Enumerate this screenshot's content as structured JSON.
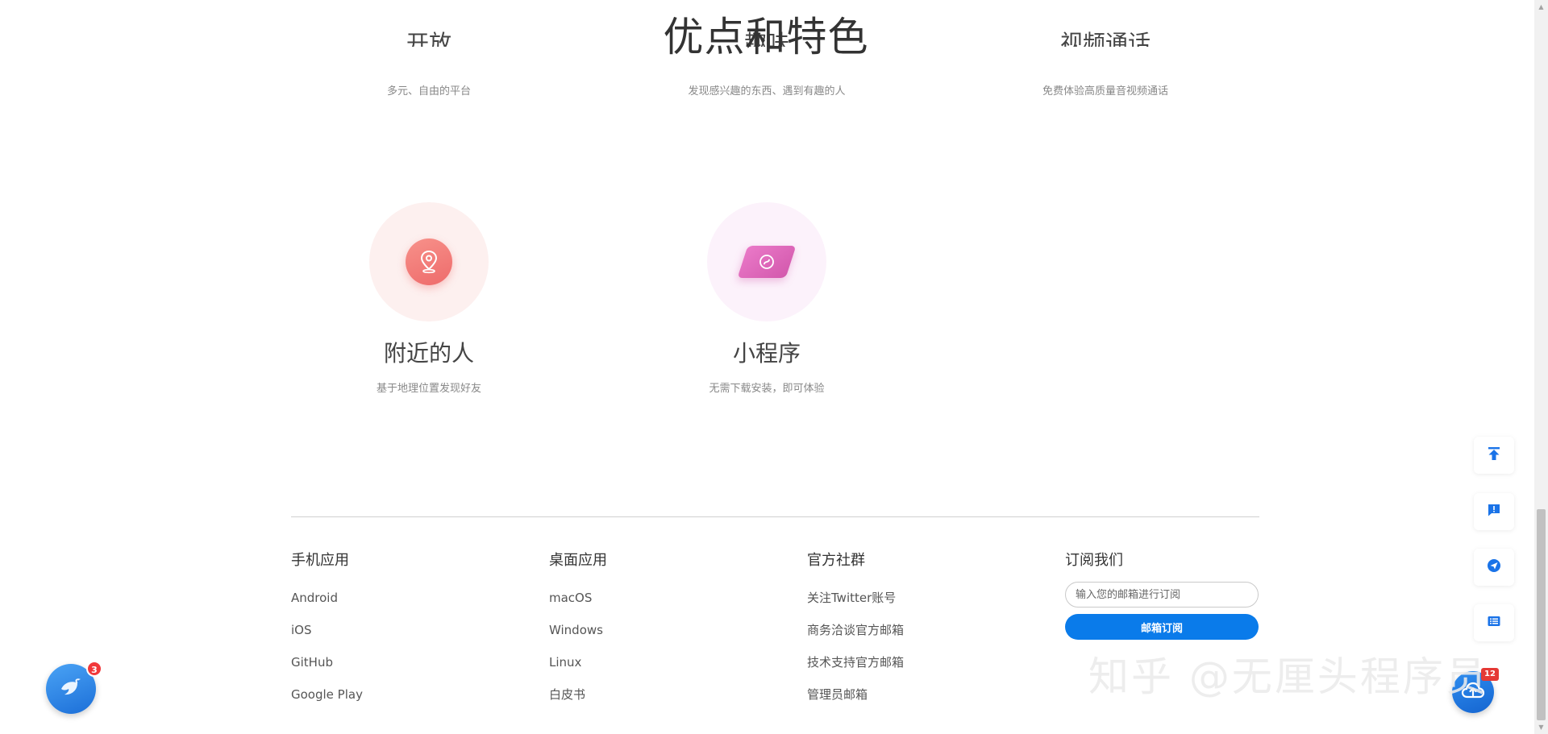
{
  "section": {
    "title": "优点和特色"
  },
  "features_row1": [
    {
      "name": "开放",
      "desc": "多元、自由的平台"
    },
    {
      "name": "趣味",
      "desc": "发现感兴趣的东西、遇到有趣的人"
    },
    {
      "name": "视频通话",
      "desc": "免费体验高质量音视频通话"
    }
  ],
  "features_row2": [
    {
      "name": "附近的人",
      "desc": "基于地理位置发现好友",
      "icon": "location-pin-icon",
      "color": "#ee6b6b"
    },
    {
      "name": "小程序",
      "desc": "无需下载安装，即可体验",
      "icon": "mini-program-icon",
      "color": "#d359ad"
    }
  ],
  "footer": {
    "mobile": {
      "title": "手机应用",
      "links": [
        "Android",
        "iOS",
        "GitHub",
        "Google Play"
      ]
    },
    "desktop": {
      "title": "桌面应用",
      "links": [
        "macOS",
        "Windows",
        "Linux",
        "白皮书"
      ]
    },
    "community": {
      "title": "官方社群",
      "links": [
        "关注Twitter账号",
        "商务洽谈官方邮箱",
        "技术支持官方邮箱",
        "管理员邮箱"
      ]
    },
    "subscribe": {
      "title": "订阅我们",
      "placeholder": "输入您的邮箱进行订阅",
      "value": "",
      "button_label": "邮箱订阅"
    }
  },
  "floating": {
    "tools": [
      "back-to-top-icon",
      "feedback-icon",
      "send-icon",
      "list-icon"
    ],
    "bird_badge": "3",
    "cloud_badge": "12"
  },
  "watermark": "知乎 @无厘头程序员",
  "colors": {
    "accent": "#0a7bea",
    "tool_icon": "#1a73e8"
  }
}
